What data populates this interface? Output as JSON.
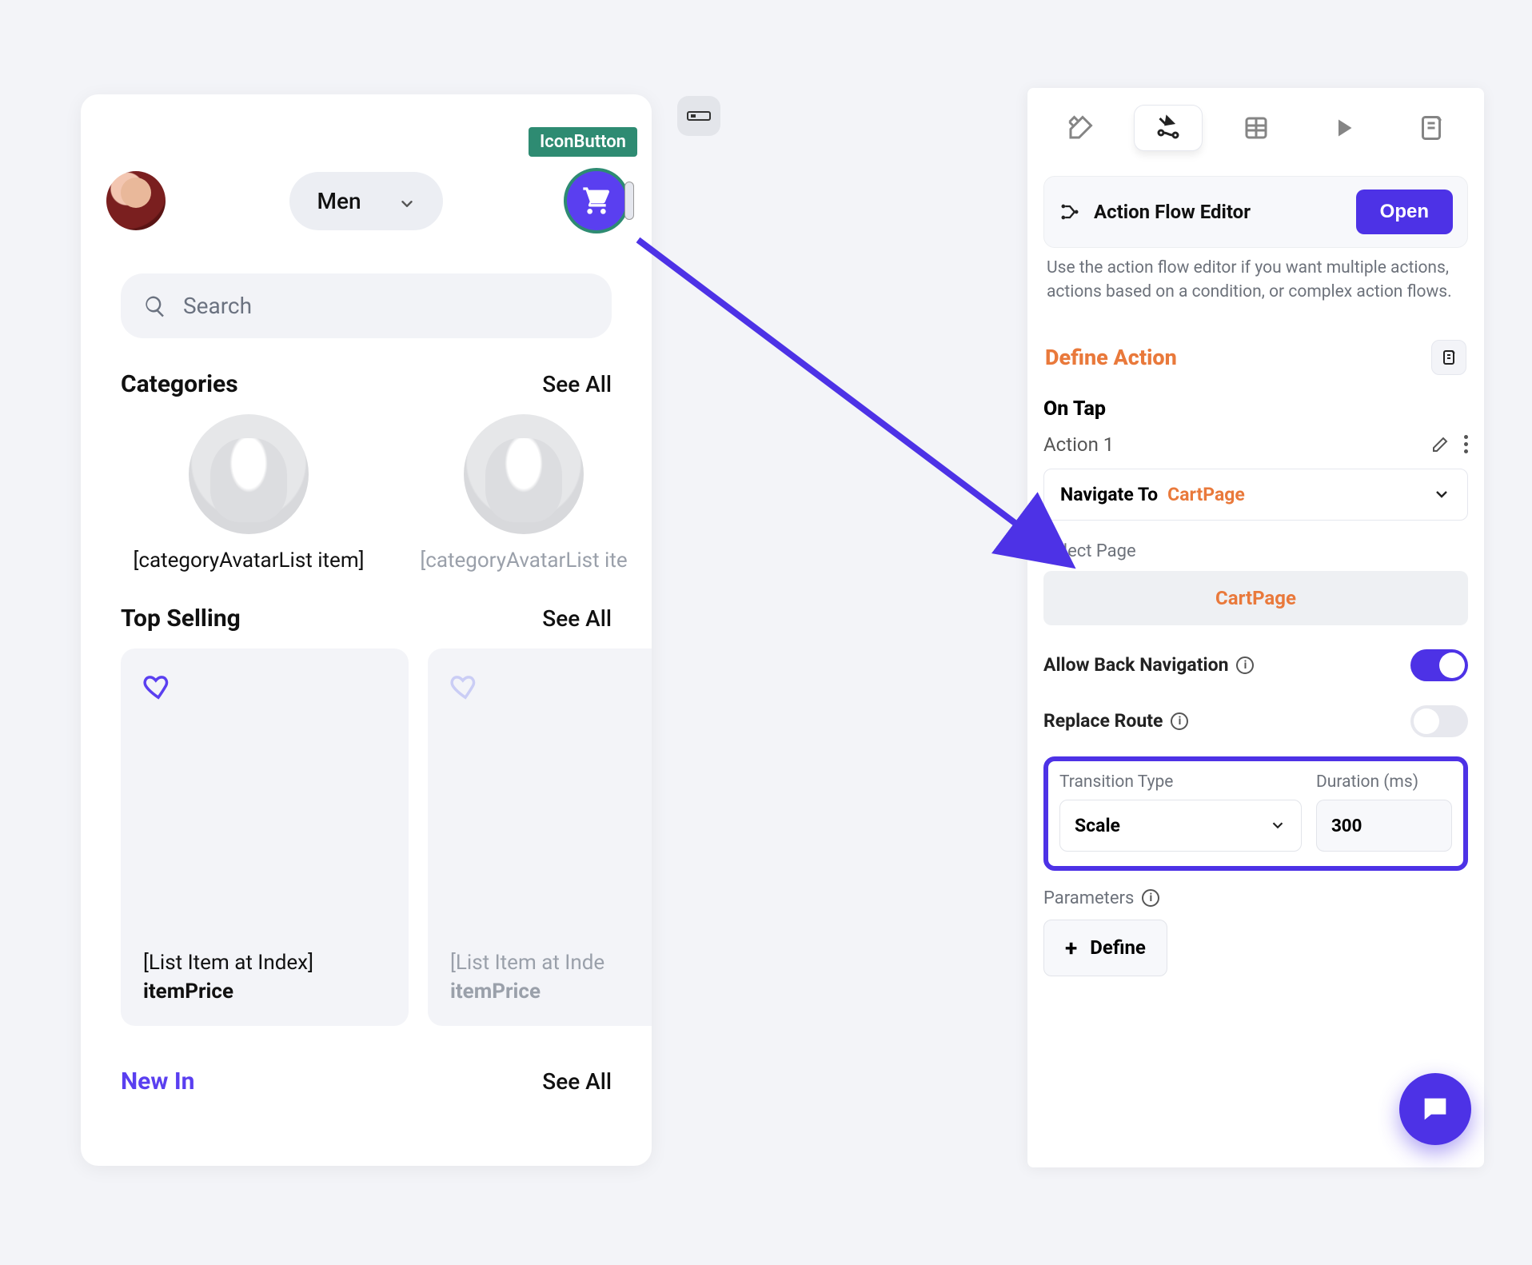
{
  "preview": {
    "selection_tag": "IconButton",
    "category_selector": "Men",
    "search_placeholder": "Search",
    "sections": {
      "categories": {
        "title": "Categories",
        "see_all": "See All"
      },
      "top_selling": {
        "title": "Top Selling",
        "see_all": "See All"
      },
      "new_in": {
        "title": "New In",
        "see_all": "See All"
      }
    },
    "category_items": [
      {
        "label": "[categoryAvatarList item]"
      },
      {
        "label": "[categoryAvatarList ite"
      }
    ],
    "top_selling_items": [
      {
        "line1": "[List Item at Index]",
        "line2": "itemPrice"
      },
      {
        "line1": "[List Item at Inde",
        "line2": "itemPrice"
      }
    ]
  },
  "panel": {
    "flow_editor": {
      "title": "Action Flow Editor",
      "open_label": "Open",
      "description": "Use the action flow editor if you want multiple actions, actions based on a condition, or complex action flows."
    },
    "define_action_title": "Define Action",
    "on_tap_label": "On Tap",
    "action_label": "Action 1",
    "navigate_action": {
      "verb": "Navigate To",
      "target": "CartPage"
    },
    "select_page_label": "Select Page",
    "selected_page": "CartPage",
    "allow_back_label": "Allow Back Navigation",
    "allow_back_value": true,
    "replace_route_label": "Replace Route",
    "replace_route_value": false,
    "transition_type_label": "Transition Type",
    "transition_type_value": "Scale",
    "duration_label": "Duration (ms)",
    "duration_value": "300",
    "parameters_label": "Parameters",
    "define_button": "Define"
  }
}
